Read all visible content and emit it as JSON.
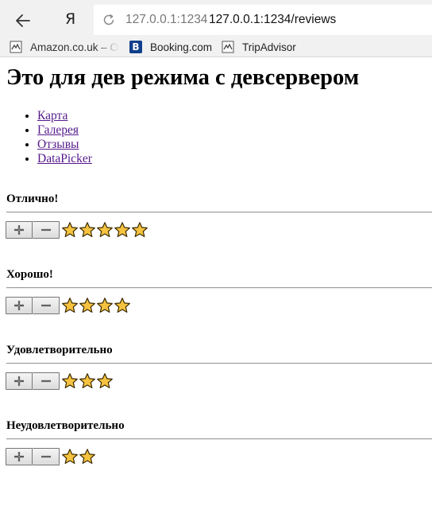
{
  "browser": {
    "logo": "Я",
    "url_host": "127.0.0.1:1234",
    "url_full": "127.0.0.1:1234/reviews"
  },
  "bookmarks": [
    {
      "label": "Amazon.co.uk – Or",
      "icon": "amazon-favicon"
    },
    {
      "label": "Booking.com",
      "icon": "booking-favicon"
    },
    {
      "label": "TripAdvisor",
      "icon": "tripadvisor-favicon"
    }
  ],
  "page": {
    "heading": "Это для дев режима с девсервером",
    "nav": [
      "Карта",
      "Галерея",
      "Отзывы",
      "DataPicker"
    ]
  },
  "reviews": [
    {
      "title": "Отлично!",
      "stars": 5
    },
    {
      "title": "Хорошо!",
      "stars": 4
    },
    {
      "title": "Удовлетворительно",
      "stars": 3
    },
    {
      "title": "Неудовлетворительно",
      "stars": 2
    }
  ],
  "colors": {
    "star_fill": "#f6c340",
    "star_stroke": "#3a2a00",
    "link": "#551a8b"
  }
}
